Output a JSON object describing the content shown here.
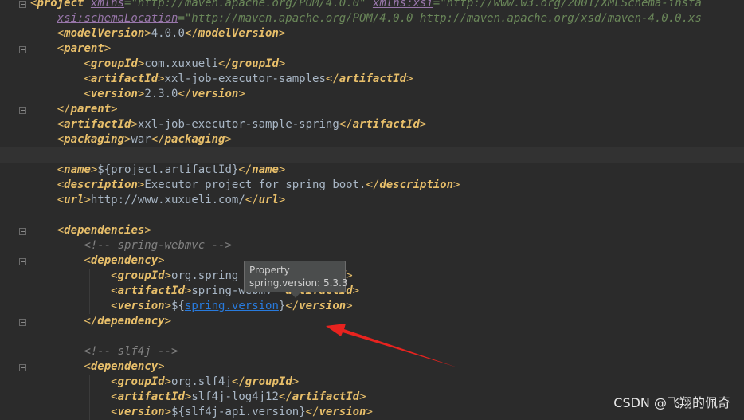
{
  "editor": {
    "lines": [
      {
        "parts": [
          {
            "t": "br",
            "v": "<"
          },
          {
            "t": "tag",
            "v": "project"
          },
          {
            "t": "txt",
            "v": " "
          },
          {
            "t": "aname",
            "v": "xmlns"
          },
          {
            "t": "str",
            "v": "=\"http://maven.apache.org/POM/4.0.0\""
          },
          {
            "t": "txt",
            "v": " "
          },
          {
            "t": "aname",
            "v": "xmlns:xsi"
          },
          {
            "t": "str",
            "v": "=\"http://www.w3.org/2001/XMLSchema-insta"
          }
        ]
      },
      {
        "parts": [
          {
            "t": "txt",
            "v": "    "
          },
          {
            "t": "aname",
            "v": "xsi:schemaLocation"
          },
          {
            "t": "str",
            "v": "=\"http://maven.apache.org/POM/4.0.0 http://maven.apache.org/xsd/maven-4.0.0.xs"
          }
        ]
      },
      {
        "parts": [
          {
            "t": "txt",
            "v": "    "
          },
          {
            "t": "br",
            "v": "<"
          },
          {
            "t": "tag",
            "v": "modelVersion"
          },
          {
            "t": "br",
            "v": ">"
          },
          {
            "t": "txt",
            "v": "4.0.0"
          },
          {
            "t": "br",
            "v": "</"
          },
          {
            "t": "tag",
            "v": "modelVersion"
          },
          {
            "t": "br",
            "v": ">"
          }
        ]
      },
      {
        "parts": [
          {
            "t": "txt",
            "v": "    "
          },
          {
            "t": "br",
            "v": "<"
          },
          {
            "t": "tag",
            "v": "parent"
          },
          {
            "t": "br",
            "v": ">"
          }
        ]
      },
      {
        "parts": [
          {
            "t": "txt",
            "v": "        "
          },
          {
            "t": "br",
            "v": "<"
          },
          {
            "t": "tag",
            "v": "groupId"
          },
          {
            "t": "br",
            "v": ">"
          },
          {
            "t": "txt",
            "v": "com.xuxueli"
          },
          {
            "t": "br",
            "v": "</"
          },
          {
            "t": "tag",
            "v": "groupId"
          },
          {
            "t": "br",
            "v": ">"
          }
        ]
      },
      {
        "parts": [
          {
            "t": "txt",
            "v": "        "
          },
          {
            "t": "br",
            "v": "<"
          },
          {
            "t": "tag",
            "v": "artifactId"
          },
          {
            "t": "br",
            "v": ">"
          },
          {
            "t": "txt",
            "v": "xxl-job-executor-samples"
          },
          {
            "t": "br",
            "v": "</"
          },
          {
            "t": "tag",
            "v": "artifactId"
          },
          {
            "t": "br",
            "v": ">"
          }
        ]
      },
      {
        "parts": [
          {
            "t": "txt",
            "v": "        "
          },
          {
            "t": "br",
            "v": "<"
          },
          {
            "t": "tag",
            "v": "version"
          },
          {
            "t": "br",
            "v": ">"
          },
          {
            "t": "txt",
            "v": "2.3.0"
          },
          {
            "t": "br",
            "v": "</"
          },
          {
            "t": "tag",
            "v": "version"
          },
          {
            "t": "br",
            "v": ">"
          }
        ]
      },
      {
        "parts": [
          {
            "t": "txt",
            "v": "    "
          },
          {
            "t": "br",
            "v": "</"
          },
          {
            "t": "tag",
            "v": "parent"
          },
          {
            "t": "br",
            "v": ">"
          }
        ]
      },
      {
        "parts": [
          {
            "t": "txt",
            "v": "    "
          },
          {
            "t": "br",
            "v": "<"
          },
          {
            "t": "tag",
            "v": "artifactId"
          },
          {
            "t": "br",
            "v": ">"
          },
          {
            "t": "txt",
            "v": "xxl-job-executor-sample-spring"
          },
          {
            "t": "br",
            "v": "</"
          },
          {
            "t": "tag",
            "v": "artifactId"
          },
          {
            "t": "br",
            "v": ">"
          }
        ]
      },
      {
        "parts": [
          {
            "t": "txt",
            "v": "    "
          },
          {
            "t": "br",
            "v": "<"
          },
          {
            "t": "tag",
            "v": "packaging"
          },
          {
            "t": "br",
            "v": ">"
          },
          {
            "t": "txt",
            "v": "war"
          },
          {
            "t": "br",
            "v": "</"
          },
          {
            "t": "tag",
            "v": "packaging"
          },
          {
            "t": "br",
            "v": ">"
          }
        ]
      },
      {
        "parts": [],
        "highlight": true
      },
      {
        "parts": [
          {
            "t": "txt",
            "v": "    "
          },
          {
            "t": "br",
            "v": "<"
          },
          {
            "t": "tag",
            "v": "name"
          },
          {
            "t": "br",
            "v": ">"
          },
          {
            "t": "txt",
            "v": "${project.artifactId}"
          },
          {
            "t": "br",
            "v": "</"
          },
          {
            "t": "tag",
            "v": "name"
          },
          {
            "t": "br",
            "v": ">"
          }
        ]
      },
      {
        "parts": [
          {
            "t": "txt",
            "v": "    "
          },
          {
            "t": "br",
            "v": "<"
          },
          {
            "t": "tag",
            "v": "description"
          },
          {
            "t": "br",
            "v": ">"
          },
          {
            "t": "txt",
            "v": "Executor project for spring boot."
          },
          {
            "t": "br",
            "v": "</"
          },
          {
            "t": "tag",
            "v": "description"
          },
          {
            "t": "br",
            "v": ">"
          }
        ]
      },
      {
        "parts": [
          {
            "t": "txt",
            "v": "    "
          },
          {
            "t": "br",
            "v": "<"
          },
          {
            "t": "tag",
            "v": "url"
          },
          {
            "t": "br",
            "v": ">"
          },
          {
            "t": "txt",
            "v": "http://www.xuxueli.com/"
          },
          {
            "t": "br",
            "v": "</"
          },
          {
            "t": "tag",
            "v": "url"
          },
          {
            "t": "br",
            "v": ">"
          }
        ]
      },
      {
        "parts": []
      },
      {
        "parts": [
          {
            "t": "txt",
            "v": "    "
          },
          {
            "t": "br",
            "v": "<"
          },
          {
            "t": "tag",
            "v": "dependencies"
          },
          {
            "t": "br",
            "v": ">"
          }
        ]
      },
      {
        "parts": [
          {
            "t": "txt",
            "v": "        "
          },
          {
            "t": "cmt",
            "v": "<!-- spring-webmvc -->"
          }
        ]
      },
      {
        "parts": [
          {
            "t": "txt",
            "v": "        "
          },
          {
            "t": "br",
            "v": "<"
          },
          {
            "t": "tag",
            "v": "dependency"
          },
          {
            "t": "br",
            "v": ">"
          }
        ]
      },
      {
        "parts": [
          {
            "t": "txt",
            "v": "            "
          },
          {
            "t": "br",
            "v": "<"
          },
          {
            "t": "tag",
            "v": "groupId"
          },
          {
            "t": "br",
            "v": ">"
          },
          {
            "t": "txt",
            "v": "org.spring"
          },
          {
            "t": "txt",
            "v": "           "
          },
          {
            "t": "tag",
            "v": "oupId"
          },
          {
            "t": "br",
            "v": ">"
          }
        ]
      },
      {
        "parts": [
          {
            "t": "txt",
            "v": "            "
          },
          {
            "t": "br",
            "v": "<"
          },
          {
            "t": "tag",
            "v": "artifactId"
          },
          {
            "t": "br",
            "v": ">"
          },
          {
            "t": "txt",
            "v": "spring-webmv"
          },
          {
            "t": "txt",
            "v": "  "
          },
          {
            "t": "tag",
            "v": "artifactId"
          },
          {
            "t": "br",
            "v": ">"
          }
        ]
      },
      {
        "parts": [
          {
            "t": "txt",
            "v": "            "
          },
          {
            "t": "br",
            "v": "<"
          },
          {
            "t": "tag",
            "v": "version"
          },
          {
            "t": "br",
            "v": ">"
          },
          {
            "t": "txt",
            "v": "${"
          },
          {
            "t": "ref",
            "v": "spring.version"
          },
          {
            "t": "txt",
            "v": "}"
          },
          {
            "t": "br",
            "v": "</"
          },
          {
            "t": "tag",
            "v": "version"
          },
          {
            "t": "br",
            "v": ">"
          }
        ]
      },
      {
        "parts": [
          {
            "t": "txt",
            "v": "        "
          },
          {
            "t": "br",
            "v": "</"
          },
          {
            "t": "tag",
            "v": "dependency"
          },
          {
            "t": "br",
            "v": ">"
          }
        ]
      },
      {
        "parts": []
      },
      {
        "parts": [
          {
            "t": "txt",
            "v": "        "
          },
          {
            "t": "cmt",
            "v": "<!-- slf4j -->"
          }
        ]
      },
      {
        "parts": [
          {
            "t": "txt",
            "v": "        "
          },
          {
            "t": "br",
            "v": "<"
          },
          {
            "t": "tag",
            "v": "dependency"
          },
          {
            "t": "br",
            "v": ">"
          }
        ]
      },
      {
        "parts": [
          {
            "t": "txt",
            "v": "            "
          },
          {
            "t": "br",
            "v": "<"
          },
          {
            "t": "tag",
            "v": "groupId"
          },
          {
            "t": "br",
            "v": ">"
          },
          {
            "t": "txt",
            "v": "org.slf4j"
          },
          {
            "t": "br",
            "v": "</"
          },
          {
            "t": "tag",
            "v": "groupId"
          },
          {
            "t": "br",
            "v": ">"
          }
        ]
      },
      {
        "parts": [
          {
            "t": "txt",
            "v": "            "
          },
          {
            "t": "br",
            "v": "<"
          },
          {
            "t": "tag",
            "v": "artifactId"
          },
          {
            "t": "br",
            "v": ">"
          },
          {
            "t": "txt",
            "v": "slf4j-log4j12"
          },
          {
            "t": "br",
            "v": "</"
          },
          {
            "t": "tag",
            "v": "artifactId"
          },
          {
            "t": "br",
            "v": ">"
          }
        ]
      },
      {
        "parts": [
          {
            "t": "txt",
            "v": "            "
          },
          {
            "t": "br",
            "v": "<"
          },
          {
            "t": "tag",
            "v": "version"
          },
          {
            "t": "br",
            "v": ">"
          },
          {
            "t": "txt",
            "v": "${slf4j-api.version}"
          },
          {
            "t": "br",
            "v": "</"
          },
          {
            "t": "tag",
            "v": "version"
          },
          {
            "t": "br",
            "v": ">"
          }
        ]
      }
    ]
  },
  "tooltip": {
    "title": "Property",
    "value": "spring.version: 5.3.3"
  },
  "watermark": "CSDN @飞翔的佩奇",
  "colors": {
    "background": "#2b2b2b",
    "tag": "#e8bf6a",
    "string": "#6a8759",
    "comment": "#808080",
    "attribute": "#9876aa",
    "reference": "#287bde",
    "arrow": "#e8231f"
  }
}
